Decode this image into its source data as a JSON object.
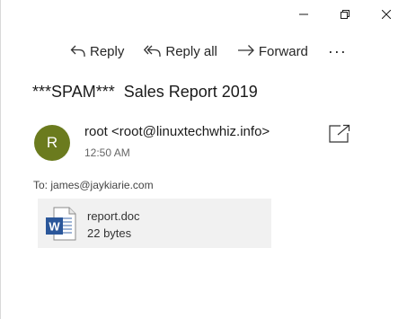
{
  "window": {
    "controls": [
      "minimize",
      "restore",
      "close"
    ]
  },
  "toolbar": {
    "reply_label": "Reply",
    "reply_all_label": "Reply all",
    "forward_label": "Forward",
    "more_label": "···"
  },
  "message": {
    "subject": "***SPAM***  Sales Report 2019",
    "sender_initial": "R",
    "avatar_color": "#6b7b1e",
    "sender": "root <root@linuxtechwhiz.info>",
    "time": "12:50 AM",
    "to_label": "To:",
    "to_address": "james@jaykiarie.com"
  },
  "attachment": {
    "name": "report.doc",
    "size": "22 bytes",
    "icon": "word-document-icon"
  }
}
